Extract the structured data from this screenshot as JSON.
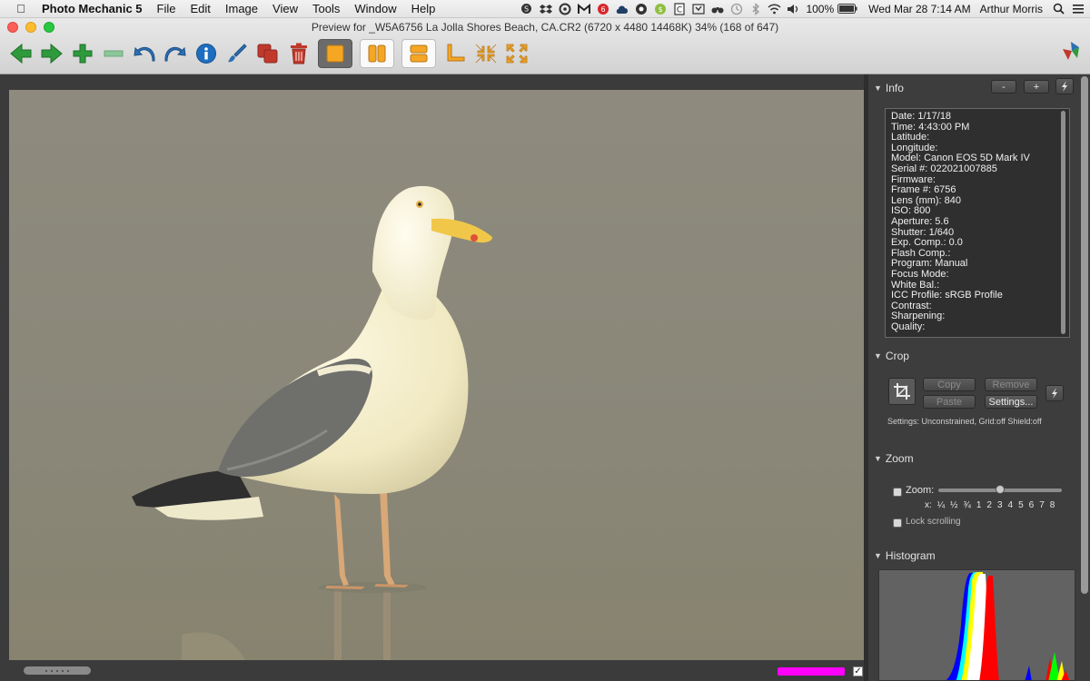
{
  "menubar": {
    "apple_icon": "apple-logo-icon",
    "app_name": "Photo Mechanic 5",
    "menus": [
      "File",
      "Edit",
      "Image",
      "View",
      "Tools",
      "Window",
      "Help"
    ],
    "tray_icons": [
      "skype-icon",
      "dropbox-icon",
      "antivirus-icon",
      "mail-icon",
      "evernote-icon",
      "creative-cloud-icon",
      "grammar-icon",
      "clipboard-icon",
      "screen-icon",
      "binoculars-icon",
      "time-machine-icon",
      "bluetooth-icon",
      "airplay-icon",
      "volume-icon",
      "battery-icon"
    ],
    "battery": "100%",
    "clock": "Wed Mar 28  7:14 AM",
    "user": "Arthur Morris"
  },
  "window": {
    "title": "Preview for _W5A6756  La Jolla Shores Beach, CA.CR2 (6720 x 4480 14468K) 34% (168 of 647)"
  },
  "toolbar": {
    "buttons": [
      {
        "name": "previous-icon",
        "color": "#2e9a3c"
      },
      {
        "name": "next-icon",
        "color": "#2e9a3c"
      },
      {
        "name": "add-icon",
        "color": "#2e9a3c"
      },
      {
        "name": "remove-icon",
        "color": "#8cc79a"
      },
      {
        "name": "rotate-left-icon",
        "color": "#2d6fb3"
      },
      {
        "name": "rotate-right-icon",
        "color": "#2d6fb3"
      },
      {
        "name": "info-icon",
        "color": "#1e6ec0"
      },
      {
        "name": "edit-brush-icon",
        "color": "#2d6fb3"
      },
      {
        "name": "copy-stack-icon",
        "color": "#c0392b"
      },
      {
        "name": "trash-icon",
        "color": "#c0392b"
      }
    ],
    "accent_orange": "#f5a623"
  },
  "panel": {
    "info": {
      "title": "Info",
      "minus_label": "-",
      "plus_label": "+",
      "lines": [
        "Date: 1/17/18",
        "Time: 4:43:00 PM",
        "Latitude:",
        "Longitude:",
        "Model: Canon EOS 5D Mark IV",
        "Serial #: 022021007885",
        "Firmware:",
        "Frame #: 6756",
        "Lens (mm): 840",
        "ISO: 800",
        "Aperture: 5.6",
        "Shutter: 1/640",
        "Exp. Comp.: 0.0",
        "Flash Comp.:",
        "Program: Manual",
        "Focus Mode:",
        "White Bal.:",
        "ICC Profile: sRGB Profile",
        "Contrast:",
        "Sharpening:",
        "Quality:"
      ]
    },
    "crop": {
      "title": "Crop",
      "copy": "Copy",
      "remove": "Remove",
      "paste": "Paste",
      "settings": "Settings...",
      "settings_text": "Settings:  Unconstrained, Grid:off Shield:off"
    },
    "zoom": {
      "title": "Zoom",
      "label": "Zoom:",
      "value": 0.5,
      "ticks": [
        "x:",
        "¼",
        "½",
        "¾",
        "1",
        "2",
        "3",
        "4",
        "5",
        "6",
        "7",
        "8"
      ],
      "lock": "Lock scrolling"
    },
    "histogram": {
      "title": "Histogram"
    }
  }
}
